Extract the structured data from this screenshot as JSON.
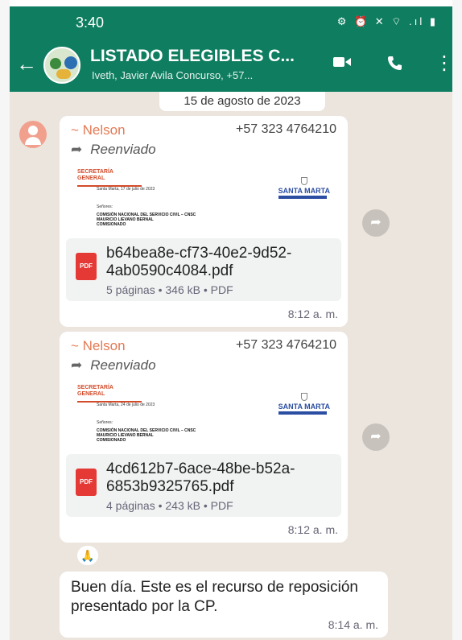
{
  "status": {
    "time": "3:40",
    "icons": "⚙ ⏰ ✕ ⌔ .ıl ▮"
  },
  "header": {
    "back_icon": "←",
    "title": "LISTADO ELEGIBLES C...",
    "subtitle": "Iveth, Javier Avila Concurso, +57...",
    "video_icon": "▶",
    "call_icon": "✆",
    "menu_icon": "⋮"
  },
  "date_separator": "15 de agosto de 2023",
  "messages": [
    {
      "sender": "~ Nelson",
      "phone": "+57 323 4764210",
      "forwarded": "Reenviado",
      "preview": {
        "org": "SECRETARÍA GENERAL",
        "date": "Santa Marta, 17 de julio de 2023",
        "addressee": "Señores:",
        "body": "COMISIÓN NACIONAL DEL SERVICIO CIVIL – CNSC\nMAURICIO LIEVANO BERNAL\nCOMISIONADO",
        "brand": "SANTA MARTA"
      },
      "file_name": "b64bea8e-cf73-40e2-9d52-4ab0590c4084.pdf",
      "file_meta": "5 páginas • 346 kB • PDF",
      "time": "8:12 a. m."
    },
    {
      "sender": "~ Nelson",
      "phone": "+57 323 4764210",
      "forwarded": "Reenviado",
      "preview": {
        "org": "SECRETARÍA GENERAL",
        "date": "Santa Marta, 24 de julio de 2023",
        "addressee": "Señores:",
        "body": "COMISIÓN NACIONAL DEL SERVICIO CIVIL – CNSC\nMAURICIO LIEVANO BERNAL\nCOMISIONADO",
        "brand": "SANTA MARTA"
      },
      "file_name": "4cd612b7-6ace-48be-b52a-6853b9325765.pdf",
      "file_meta": "4 páginas • 243 kB • PDF",
      "time": "8:12 a. m."
    },
    {
      "text": "Buen día. Este es el recurso de reposición presentado por la CP.",
      "time": "8:14 a. m."
    }
  ],
  "reaction": "🙏",
  "pdf_label": "PDF",
  "colors": {
    "header": "#0f7d60",
    "sender": "#e47a54",
    "chat_bg": "#ece5dd"
  }
}
